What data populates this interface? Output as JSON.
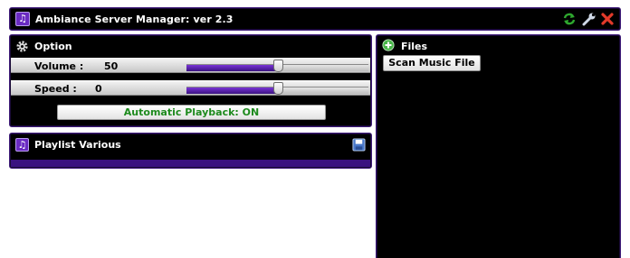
{
  "window": {
    "title": "Ambiance Server Manager: ver 2.3",
    "icons": [
      "music-note-icon",
      "refresh-icon",
      "wrench-icon",
      "close-icon"
    ]
  },
  "option": {
    "title": "Option",
    "icon": "gear-icon",
    "volume": {
      "label": "Volume :",
      "value": "50",
      "level": 0.5
    },
    "speed": {
      "label": "Speed :",
      "value": "0",
      "level": 0.5
    },
    "playback_button": "Automatic Playback: ON",
    "playback_color": "#1d8a1d"
  },
  "playlist": {
    "title": "Playlist Various",
    "icons": [
      "music-note-icon",
      "save-icon"
    ]
  },
  "files": {
    "title": "Files",
    "icon": "add-icon",
    "scan_button": "Scan Music File"
  },
  "colors": {
    "accent": "#3a1280",
    "panel_bg": "#000000",
    "text": "#ffffff"
  }
}
